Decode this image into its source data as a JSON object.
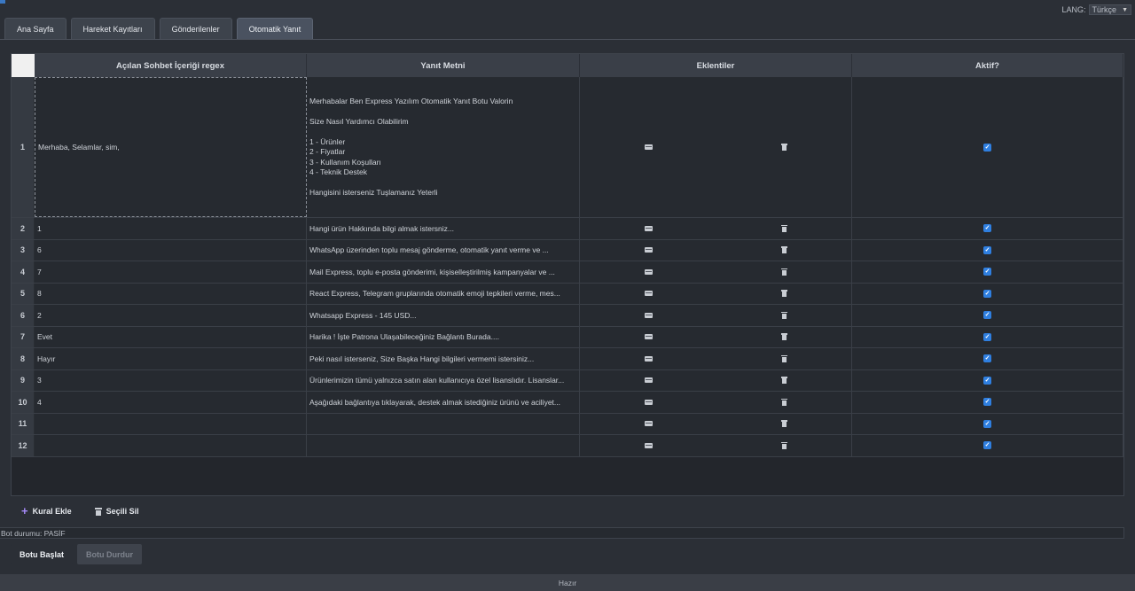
{
  "lang": {
    "label": "LANG:",
    "value": "Türkçe"
  },
  "tabs": [
    {
      "label": "Ana Sayfa"
    },
    {
      "label": "Hareket Kayıtları"
    },
    {
      "label": "Gönderilenler"
    },
    {
      "label": "Otomatik Yanıt"
    }
  ],
  "table": {
    "headers": [
      "Açılan Sohbet İçeriği regex",
      "Yanıt Metni",
      "Eklentiler",
      "Aktif?"
    ],
    "rows": [
      {
        "num": "1",
        "regex": "Merhaba, Selamlar, sim,",
        "reply": "Merhabalar Ben Express Yazılım Otomatik Yanıt Botu Valorin\n\nSize Nasıl Yardımcı Olabilirim\n\n1 - Ürünler\n2 - Fiyatlar\n3 - Kullanım Koşulları\n4 - Teknik Destek\n\nHangisini isterseniz Tuşlamanız Yeterli"
      },
      {
        "num": "2",
        "regex": "1",
        "reply": "Hangi ürün Hakkında bilgi almak istersniz..."
      },
      {
        "num": "3",
        "regex": "6",
        "reply": "WhatsApp üzerinden toplu mesaj gönderme, otomatik yanıt verme ve ..."
      },
      {
        "num": "4",
        "regex": "7",
        "reply": "Mail Express, toplu e-posta gönderimi, kişiselleştirilmiş kampanyalar ve ..."
      },
      {
        "num": "5",
        "regex": "8",
        "reply": "React Express, Telegram gruplarında otomatik emoji tepkileri verme, mes..."
      },
      {
        "num": "6",
        "regex": "2",
        "reply": "Whatsapp Express - 145 USD..."
      },
      {
        "num": "7",
        "regex": "Evet",
        "reply": "Harika ! İşte Patrona Ulaşabileceğiniz Bağlantı Burada...."
      },
      {
        "num": "8",
        "regex": "Hayır",
        "reply": "Peki nasıl isterseniz, Size Başka Hangi bilgileri vermemi istersiniz..."
      },
      {
        "num": "9",
        "regex": "3",
        "reply": "Ürünlerimizin tümü yalnızca satın alan kullanıcıya özel lisanslıdır. Lisanslar..."
      },
      {
        "num": "10",
        "regex": "4",
        "reply": "Aşağıdaki bağlantıya tıklayarak, destek almak istediğiniz ürünü ve aciliyet..."
      },
      {
        "num": "11",
        "regex": "",
        "reply": ""
      },
      {
        "num": "12",
        "regex": "",
        "reply": ""
      }
    ]
  },
  "actions": {
    "add_rule": "Kural Ekle",
    "delete_selected": "Seçili Sil"
  },
  "bot_status": "Bot durumu: PASİF",
  "buttons": {
    "start": "Botu Başlat",
    "stop": "Botu Durdur"
  },
  "footer": {
    "status": "Hazır"
  },
  "colors": {
    "accent": "#2f7fe0",
    "plus": "#a78bfa"
  }
}
